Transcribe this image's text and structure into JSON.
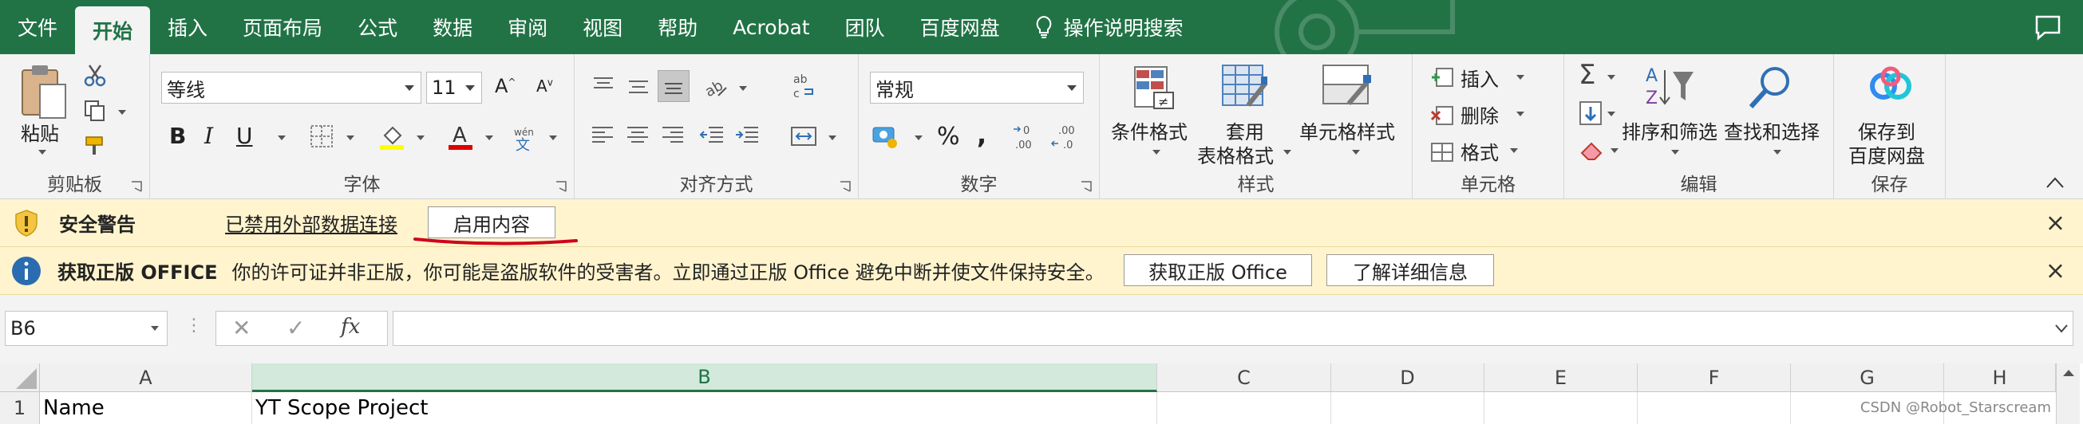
{
  "menu": {
    "tabs": [
      "文件",
      "开始",
      "插入",
      "页面布局",
      "公式",
      "数据",
      "审阅",
      "视图",
      "帮助",
      "Acrobat",
      "团队",
      "百度网盘"
    ],
    "active_tab": "开始",
    "tell_me": "操作说明搜索"
  },
  "ribbon": {
    "clipboard": {
      "paste": "粘贴",
      "label": "剪贴板"
    },
    "font": {
      "name": "等线",
      "size": "11",
      "label": "字体"
    },
    "alignment": {
      "label": "对齐方式"
    },
    "number": {
      "format": "常规",
      "label": "数字"
    },
    "styles": {
      "conditional": "条件格式",
      "table_line1": "套用",
      "table_line2": "表格格式",
      "cell_styles": "单元格样式",
      "label": "样式"
    },
    "cells": {
      "insert": "插入",
      "delete": "删除",
      "format": "格式",
      "label": "单元格"
    },
    "editing": {
      "sort": "排序和筛选",
      "find": "查找和选择",
      "label": "编辑"
    },
    "save": {
      "line1": "保存到",
      "line2": "百度网盘",
      "label": "保存"
    }
  },
  "security_bar": {
    "title": "安全警告",
    "message": "已禁用外部数据连接",
    "button": "启用内容"
  },
  "office_bar": {
    "title": "获取正版 OFFICE",
    "message": "你的许可证并非正版，你可能是盗版软件的受害者。立即通过正版 Office 避免中断并使文件保持安全。",
    "button_get": "获取正版 Office",
    "button_learn": "了解详细信息"
  },
  "formula_bar": {
    "name_box": "B6",
    "fx": "fx",
    "formula": ""
  },
  "grid": {
    "columns": [
      "A",
      "B",
      "C",
      "D",
      "E",
      "F",
      "G",
      "H"
    ],
    "selected_column": "B",
    "rows": [
      {
        "num": "1",
        "cells": [
          "Name",
          "YT Scope Project"
        ]
      }
    ]
  },
  "watermark": "CSDN @Robot_Starscream",
  "colors": {
    "excel_green": "#217346",
    "warning_bg": "#fff4ce",
    "annotation_red": "#d0021b"
  }
}
